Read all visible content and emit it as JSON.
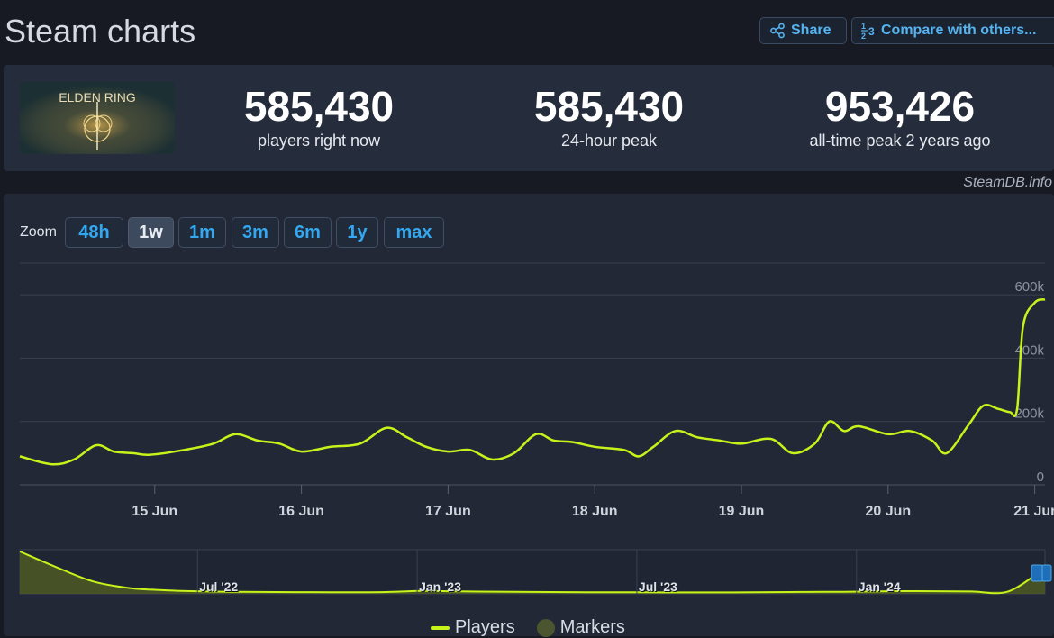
{
  "page": {
    "title": "Steam charts"
  },
  "actions": {
    "share_label": "Share",
    "compare_label": "Compare with others...",
    "share_icon": "share-icon",
    "compare_icon": "fraction-icon"
  },
  "game": {
    "logo_text": "ELDEN RING"
  },
  "stats": [
    {
      "value": "585,430",
      "label": "players right now"
    },
    {
      "value": "585,430",
      "label": "24-hour peak"
    },
    {
      "value": "953,426",
      "label": "all-time peak 2 years ago"
    }
  ],
  "credit": "SteamDB.info",
  "zoom": {
    "label": "Zoom",
    "options": [
      "48h",
      "1w",
      "1m",
      "3m",
      "6m",
      "1y",
      "max"
    ],
    "active": "1w"
  },
  "legend": {
    "players": "Players",
    "markers": "Markers"
  },
  "colors": {
    "accent": "#c8f31a",
    "link": "#33a8f0",
    "markers": "#4b5530"
  },
  "chart_data": [
    {
      "type": "line",
      "title": "",
      "xlabel": "",
      "ylabel": "",
      "x_ticks": [
        "15 Jun",
        "16 Jun",
        "17 Jun",
        "18 Jun",
        "19 Jun",
        "20 Jun",
        "21 Jun"
      ],
      "y_ticks": [
        "0",
        "200k",
        "400k",
        "600k"
      ],
      "ylim": [
        0,
        700000
      ],
      "grid": true,
      "series": [
        {
          "name": "Players",
          "x_days": [
            14.08,
            14.3,
            14.45,
            14.6,
            14.72,
            14.85,
            14.97,
            15.2,
            15.4,
            15.55,
            15.7,
            15.85,
            16.0,
            16.2,
            16.4,
            16.58,
            16.72,
            16.85,
            17.0,
            17.15,
            17.3,
            17.45,
            17.6,
            17.72,
            17.85,
            18.0,
            18.2,
            18.3,
            18.4,
            18.55,
            18.7,
            18.85,
            19.0,
            19.2,
            19.35,
            19.5,
            19.6,
            19.7,
            19.8,
            20.0,
            20.15,
            20.3,
            20.4,
            20.55,
            20.65,
            20.75,
            20.83,
            20.88,
            20.92,
            21.0,
            21.07
          ],
          "values": [
            90000,
            65000,
            80000,
            125000,
            105000,
            100000,
            95000,
            110000,
            130000,
            160000,
            140000,
            130000,
            105000,
            120000,
            130000,
            180000,
            150000,
            120000,
            105000,
            110000,
            80000,
            100000,
            160000,
            140000,
            135000,
            120000,
            110000,
            90000,
            120000,
            170000,
            150000,
            140000,
            130000,
            145000,
            100000,
            130000,
            200000,
            170000,
            185000,
            160000,
            170000,
            140000,
            100000,
            190000,
            250000,
            240000,
            230000,
            240000,
            500000,
            575000,
            585430
          ]
        }
      ]
    },
    {
      "type": "area",
      "title": "",
      "x_ticks": [
        "Jul '22",
        "Jan '23",
        "Jul '23",
        "Jan '24"
      ],
      "series": [
        {
          "name": "Players",
          "x": [
            "2022-02",
            "2022-03",
            "2022-04",
            "2022-05",
            "2022-06",
            "2022-07",
            "2022-08",
            "2022-09",
            "2022-10",
            "2022-11",
            "2022-12",
            "2023-01",
            "2023-02",
            "2023-03",
            "2023-04",
            "2023-05",
            "2023-06",
            "2023-07",
            "2023-08",
            "2023-09",
            "2023-10",
            "2023-11",
            "2023-12",
            "2024-01",
            "2024-02",
            "2024-03",
            "2024-04",
            "2024-05",
            "2024-06"
          ],
          "values": [
            953426,
            600000,
            280000,
            130000,
            80000,
            55000,
            45000,
            40000,
            38000,
            36000,
            40000,
            65000,
            55000,
            48000,
            42000,
            38000,
            36000,
            34000,
            33000,
            32000,
            35000,
            40000,
            45000,
            50000,
            60000,
            58000,
            52000,
            55000,
            585430
          ]
        }
      ]
    }
  ]
}
